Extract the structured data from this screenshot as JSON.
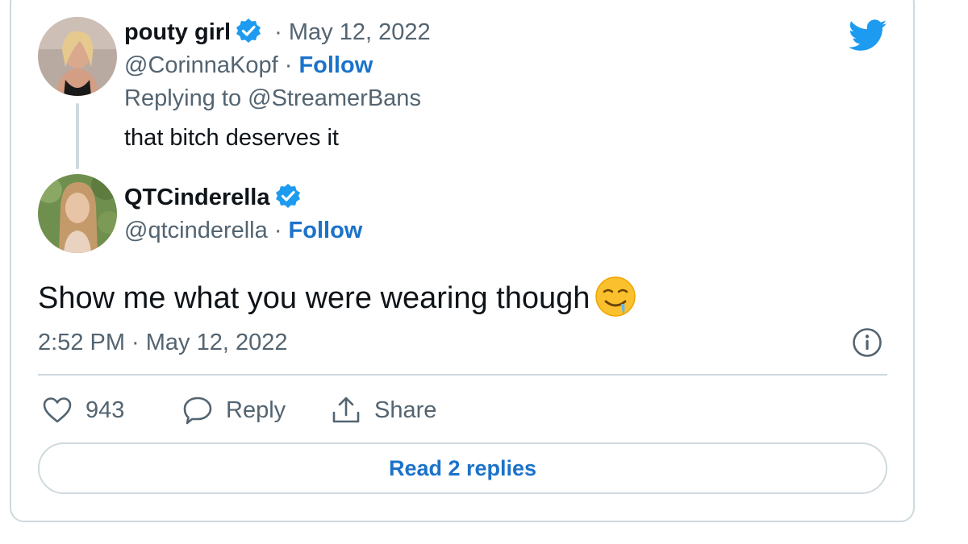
{
  "colors": {
    "accent": "#1b72c9",
    "verified": "#1d9bf0",
    "muted": "#536471",
    "border": "#cfd9de"
  },
  "parent_tweet": {
    "display_name": "pouty girl",
    "date": "· May 12, 2022",
    "handle": "@CorinnaKopf",
    "separator": " · ",
    "follow_label": "Follow",
    "replying_to": "Replying to @StreamerBans",
    "text": "that bitch deserves it"
  },
  "main_tweet": {
    "display_name": "QTCinderella",
    "handle": "@qtcinderella",
    "separator": " · ",
    "follow_label": "Follow",
    "text": "Show me what you were wearing though",
    "emoji_icon": "drooling-face-icon",
    "timestamp": "2:52 PM · May 12, 2022"
  },
  "actions": {
    "like_count": "943",
    "reply_label": "Reply",
    "share_label": "Share"
  },
  "read_replies_label": "Read 2 replies"
}
